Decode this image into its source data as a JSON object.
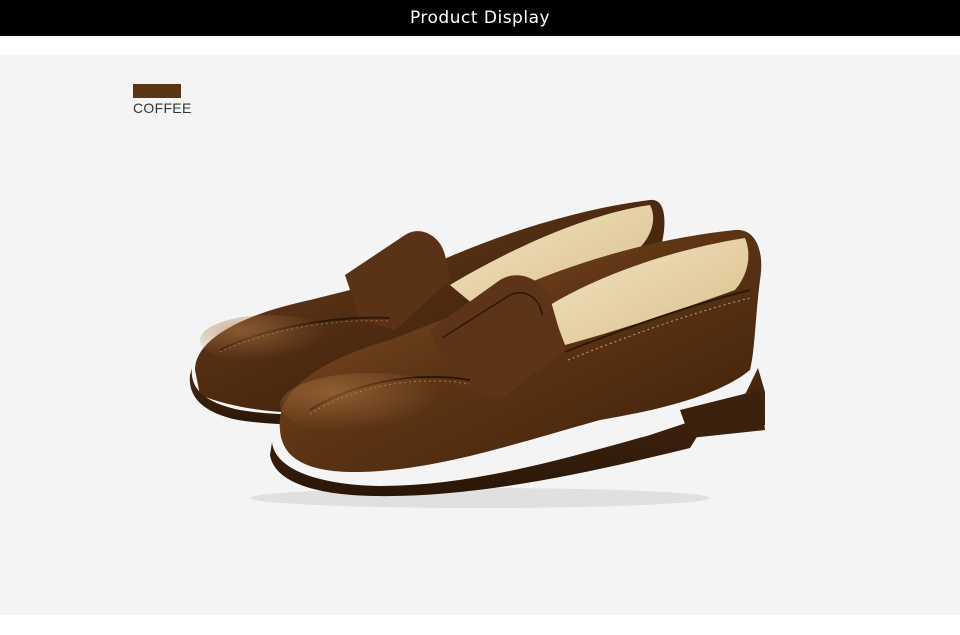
{
  "header": {
    "title": "Product Display"
  },
  "color_option": {
    "name": "COFFEE",
    "swatch_color": "#5a3615"
  },
  "product": {
    "image_subject": "pair-of-brown-leather-penny-loafers"
  },
  "colors": {
    "header_background": "#000000",
    "stage_background": "#f4f4f4"
  }
}
